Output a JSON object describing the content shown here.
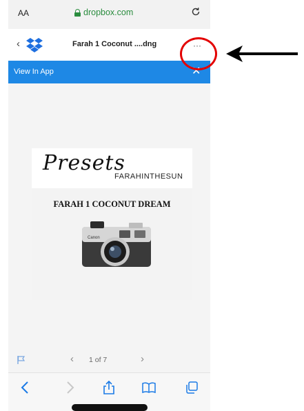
{
  "browser": {
    "text_size_label": "AA",
    "url": "dropbox.com"
  },
  "dropbox": {
    "back_label": "‹",
    "file_title": "Farah 1 Coconut ....dng",
    "more_label": "···"
  },
  "banner": {
    "text": "View In App",
    "close": "✕"
  },
  "document": {
    "script_title": "Presets",
    "brand": "FARAHINTHESUN",
    "preset_name": "FARAH 1 COCONUT DREAM",
    "camera_brand": "Canon"
  },
  "pager": {
    "prev": "‹",
    "page_count": "1 of 7",
    "next": "›"
  },
  "colors": {
    "banner_blue": "#1e88e5",
    "url_green": "#2a8c3e",
    "annotation_red": "#e30000",
    "safari_blue": "#1a7ae6"
  },
  "icons": [
    "lock-icon",
    "reload-icon",
    "dropbox-logo-icon",
    "flag-icon",
    "back-arrow-icon",
    "forward-arrow-icon",
    "share-icon",
    "bookmarks-icon",
    "tabs-icon"
  ]
}
